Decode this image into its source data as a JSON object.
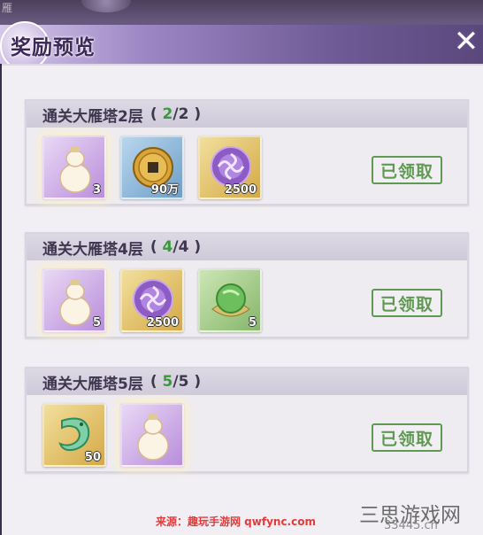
{
  "backdrop_text": "雁",
  "header": {
    "title": "奖励预览"
  },
  "rows": [
    {
      "title": "通关大雁塔2层",
      "progress_current": "2",
      "progress_total": "2",
      "status": "已领取",
      "items": [
        {
          "icon": "gourd-icon",
          "quality": "purple",
          "count": "3"
        },
        {
          "icon": "coin-icon",
          "quality": "blue",
          "count": "90万"
        },
        {
          "icon": "swirl-orb-icon",
          "quality": "gold",
          "count": "2500"
        }
      ]
    },
    {
      "title": "通关大雁塔4层",
      "progress_current": "4",
      "progress_total": "4",
      "status": "已领取",
      "items": [
        {
          "icon": "gourd-icon",
          "quality": "purple",
          "count": "5"
        },
        {
          "icon": "swirl-orb-icon",
          "quality": "gold",
          "count": "2500"
        },
        {
          "icon": "green-orb-icon",
          "quality": "green",
          "count": "5"
        }
      ]
    },
    {
      "title": "通关大雁塔5层",
      "progress_current": "5",
      "progress_total": "5",
      "status": "已领取",
      "items": [
        {
          "icon": "jade-dragon-icon",
          "quality": "gold",
          "count": "50"
        },
        {
          "icon": "gourd-icon",
          "quality": "purple",
          "count": ""
        }
      ]
    }
  ],
  "watermark": {
    "source": "来源：趣玩手游网 qwfync.com",
    "logo": "三思游戏网",
    "domain": "33445.cn"
  },
  "colors": {
    "accent_purple": "#6e5a95",
    "progress_green": "#3a9a3a",
    "stamp_green": "#5f9a53"
  }
}
